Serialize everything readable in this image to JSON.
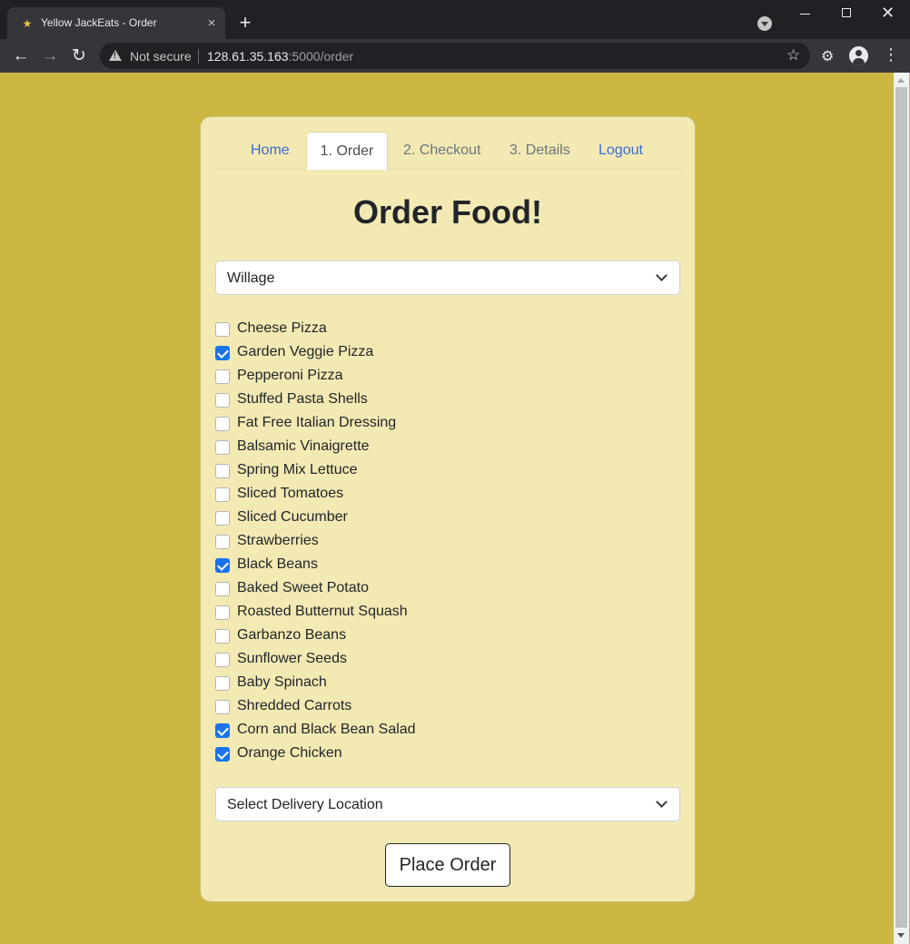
{
  "browser": {
    "tab_title": "Yellow JackEats - Order",
    "tab_favicon": "bee-icon",
    "url_security": "Not secure",
    "url_host": "128.61.35.163",
    "url_rest": ":5000/order"
  },
  "nav": {
    "items": [
      {
        "label": "Home"
      },
      {
        "label": "1. Order"
      },
      {
        "label": "2. Checkout"
      },
      {
        "label": "3. Details"
      },
      {
        "label": "Logout"
      }
    ]
  },
  "page": {
    "heading": "Order Food!",
    "restaurant_select": {
      "value": "Willage"
    },
    "items": [
      {
        "label": "Cheese Pizza",
        "checked": false
      },
      {
        "label": "Garden Veggie Pizza",
        "checked": true
      },
      {
        "label": "Pepperoni Pizza",
        "checked": false
      },
      {
        "label": "Stuffed Pasta Shells",
        "checked": false
      },
      {
        "label": "Fat Free Italian Dressing",
        "checked": false
      },
      {
        "label": "Balsamic Vinaigrette",
        "checked": false
      },
      {
        "label": "Spring Mix Lettuce",
        "checked": false
      },
      {
        "label": "Sliced Tomatoes",
        "checked": false
      },
      {
        "label": "Sliced Cucumber",
        "checked": false
      },
      {
        "label": "Strawberries",
        "checked": false
      },
      {
        "label": "Black Beans",
        "checked": true
      },
      {
        "label": "Baked Sweet Potato",
        "checked": false
      },
      {
        "label": "Roasted Butternut Squash",
        "checked": false
      },
      {
        "label": "Garbanzo Beans",
        "checked": false
      },
      {
        "label": "Sunflower Seeds",
        "checked": false
      },
      {
        "label": "Baby Spinach",
        "checked": false
      },
      {
        "label": "Shredded Carrots",
        "checked": false
      },
      {
        "label": "Corn and Black Bean Salad",
        "checked": true
      },
      {
        "label": "Orange Chicken",
        "checked": true
      }
    ],
    "location_select": {
      "value": "Select Delivery Location"
    },
    "place_order_label": "Place Order"
  },
  "colors": {
    "page_background": "#cbb742",
    "card_background": "#f3e9b3",
    "link": "#3a6ad0",
    "checkbox_checked": "#1a73e8"
  }
}
